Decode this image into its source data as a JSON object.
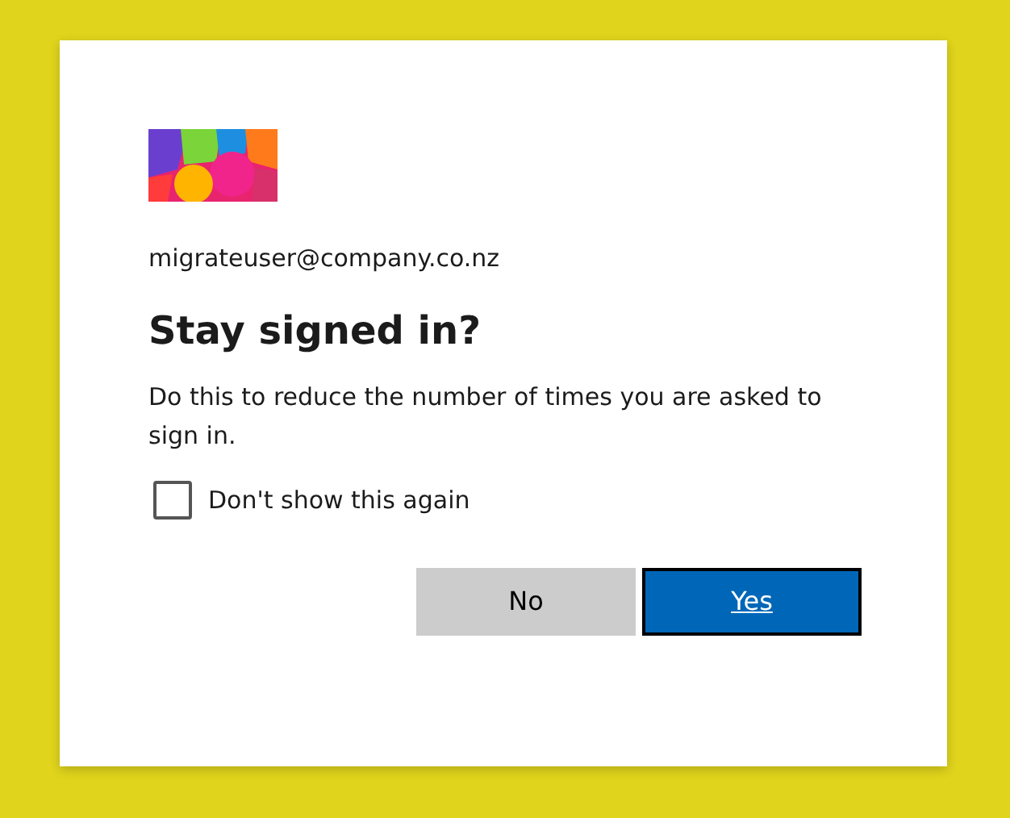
{
  "email": "migrateuser@company.co.nz",
  "title": "Stay signed in?",
  "description": "Do this to reduce the number of times you are asked to sign in.",
  "checkbox": {
    "label": "Don't show this again",
    "checked": false
  },
  "buttons": [
    {
      "label": "No",
      "kind": "secondary"
    },
    {
      "label": "Yes",
      "kind": "primary"
    }
  ]
}
